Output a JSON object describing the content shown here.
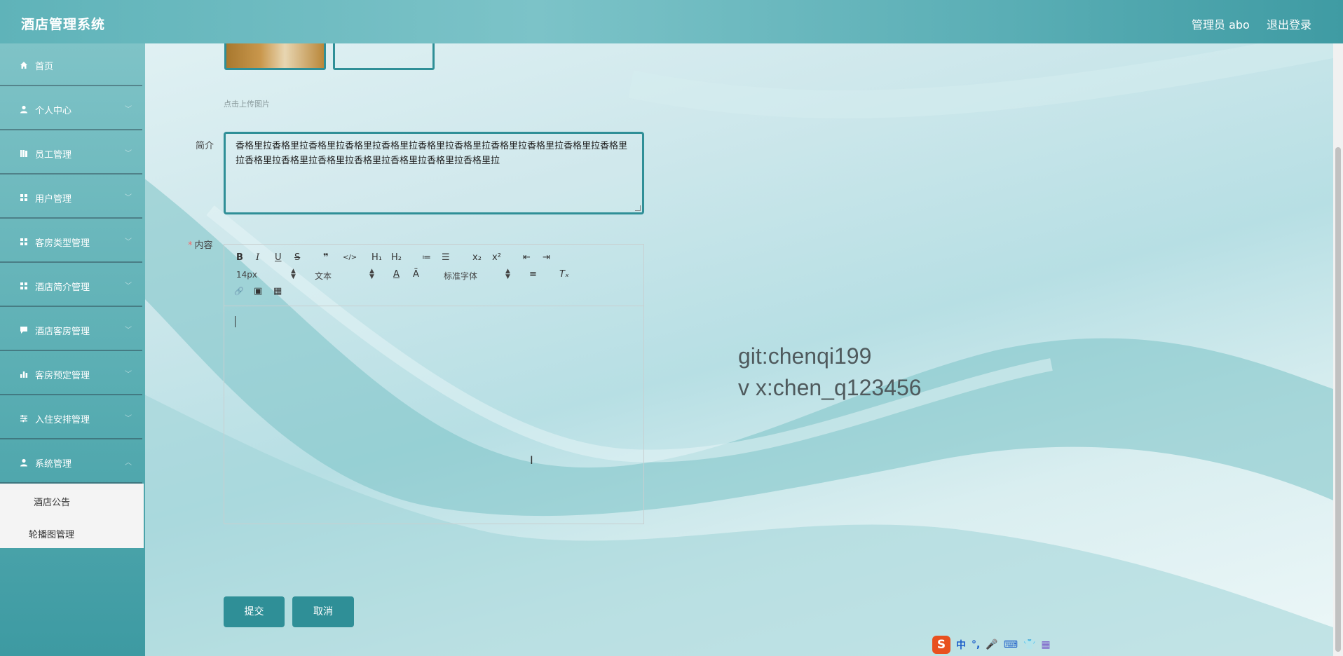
{
  "header": {
    "app_title": "酒店管理系统",
    "admin_label": "管理员 abo",
    "logout_label": "退出登录"
  },
  "sidebar": {
    "items": [
      {
        "label": "首页",
        "icon": "home-icon"
      },
      {
        "label": "个人中心",
        "icon": "user-icon"
      },
      {
        "label": "员工管理",
        "icon": "book-icon"
      },
      {
        "label": "用户管理",
        "icon": "grid-icon"
      },
      {
        "label": "客房类型管理",
        "icon": "grid-icon"
      },
      {
        "label": "酒店简介管理",
        "icon": "grid-icon"
      },
      {
        "label": "酒店客房管理",
        "icon": "comment-icon"
      },
      {
        "label": "客房预定管理",
        "icon": "bar-chart-icon"
      },
      {
        "label": "入住安排管理",
        "icon": "sliders-icon"
      },
      {
        "label": "系统管理",
        "icon": "user-icon"
      }
    ],
    "submenu": [
      {
        "label": "酒店公告"
      },
      {
        "label": "轮播图管理"
      }
    ]
  },
  "form": {
    "upload_hint": "点击上传图片",
    "desc_label": "简介",
    "desc_value": "香格里拉香格里拉香格里拉香格里拉香格里拉香格里拉香格里拉香格里拉香格里拉香格里拉香格里拉香格里拉香格里拉香格里拉香格里拉香格里拉香格里拉香格里拉",
    "content_label": "内容",
    "required_mark": "*",
    "editor": {
      "font_size": "14px",
      "block_format": "文本",
      "font_family": "标准字体",
      "buttons": {
        "bold": "B",
        "italic": "I",
        "underline": "U",
        "strike": "S",
        "blockquote": "❞",
        "code": "</>",
        "h1": "H₁",
        "h2": "H₂",
        "ordered_list": "≔",
        "bullet_list": "☰",
        "subscript": "x₂",
        "superscript": "x²",
        "outdent": "⇤",
        "indent": "⇥",
        "font_color": "A",
        "background": "Ä",
        "align": "≡",
        "clean": "Tₓ",
        "link": "🔗",
        "image": "▣",
        "video": "▦"
      }
    },
    "submit_label": "提交",
    "cancel_label": "取消"
  },
  "watermark": {
    "line1": "git:chenqi199",
    "line2": "v x:chen_q123456"
  },
  "ime": {
    "logo": "S",
    "lang": "中",
    "punct": "°,",
    "mic": "🎤",
    "keyboard": "⌨",
    "skin": "👕",
    "apps": "▦"
  }
}
